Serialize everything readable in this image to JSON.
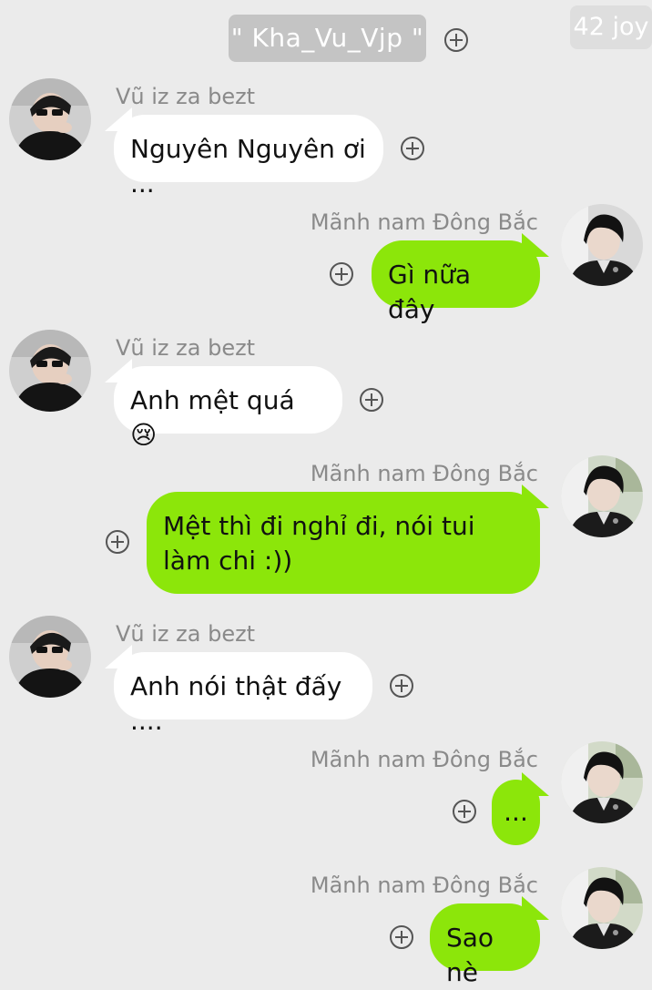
{
  "header": {
    "title": "\" Kha_Vu_Vjp \""
  },
  "watermark": "42 joy",
  "contacts": {
    "left_name": "Vũ iz za bezt",
    "right_name": "Mãnh nam Đông Bắc"
  },
  "messages": [
    {
      "side": "left",
      "sender": "Vũ iz za bezt",
      "text": "Nguyên Nguyên ơi ..."
    },
    {
      "side": "right",
      "sender": "Mãnh nam Đông Bắc",
      "text": "Gì nữa đây"
    },
    {
      "side": "left",
      "sender": "Vũ iz za bezt",
      "text": "Anh mệt quá 😢"
    },
    {
      "side": "right",
      "sender": "Mãnh nam Đông Bắc",
      "text": "Mệt thì đi nghỉ đi, nói tui làm chi :))"
    },
    {
      "side": "left",
      "sender": "Vũ iz za bezt",
      "text": "Anh nói thật đấy ...."
    },
    {
      "side": "right",
      "sender": "Mãnh nam Đông Bắc",
      "text": "..."
    },
    {
      "side": "right",
      "sender": "Mãnh nam Đông Bắc",
      "text": "Sao nè"
    }
  ],
  "icons": {
    "add_reaction": "plus-circle-icon",
    "crying_emoji": "crying-face-icon"
  },
  "colors": {
    "background": "#ebebeb",
    "incoming_bubble": "#ffffff",
    "outgoing_bubble": "#8ce60a",
    "header_bg": "#c4c4c4",
    "sender_text": "#8a8a8a"
  }
}
